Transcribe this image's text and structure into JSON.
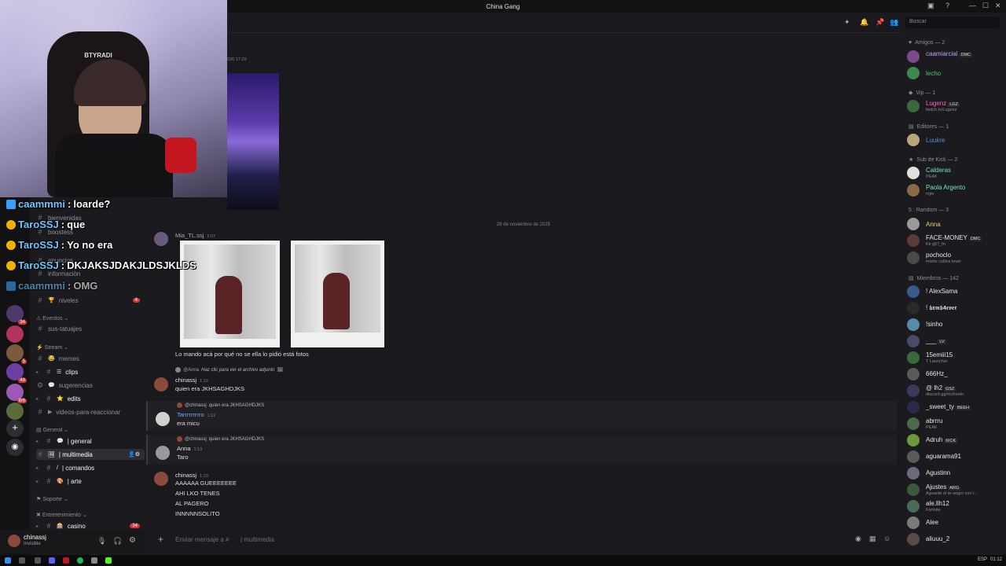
{
  "window": {
    "title": "China Gang"
  },
  "header": {
    "search_placeholder": "Buscar"
  },
  "chat_overlay": [
    {
      "user": "caammmi",
      "text": "loarde?"
    },
    {
      "user": "TaroSSJ",
      "text": "que"
    },
    {
      "user": "TaroSSJ",
      "text": "Yo no era"
    },
    {
      "user": "TaroSSJ",
      "text": "DKJAKSJDAKJLDSJKLDS"
    },
    {
      "user": "caammmi",
      "text": "OMG"
    }
  ],
  "channels": {
    "hidden": [
      {
        "name": "bienvenidas"
      },
      {
        "name": "boostess"
      },
      {
        "name": "anuncios"
      },
      {
        "name": "información"
      }
    ],
    "niveles": {
      "name": "niveles",
      "count": "4"
    },
    "cat_eventos": "Eventos",
    "sus_tatuajes": "sus-tatuajes",
    "cat_stream": "Stream",
    "memes": "memes",
    "clips": "clips",
    "sugerencias": "sugerencias",
    "edits": "edits",
    "videos": "videos-para-reaccionar",
    "cat_general": "General",
    "general": "| general",
    "multimedia": "| multimedia",
    "comandos": "| comandos",
    "arte": "| arte",
    "cat_soporte": "Soporte",
    "cat_entretenimiento": "Entretenimiento",
    "casino": "casino",
    "casino_count": "34"
  },
  "user_panel": {
    "name": "chinassj",
    "status": "Invisible"
  },
  "servers_badges": [
    "34",
    "5",
    "49",
    "8/8"
  ],
  "main": {
    "prev_time": "2020 17:29",
    "date_divider": "28 de noviembre de 2025",
    "poster": {
      "name": "Mia_TL.ssj",
      "time": "3:07"
    },
    "caption": "Lo mando acá por qué no se ella lo pidió está fotos",
    "messages": [
      {
        "reply_name": "@Anna",
        "reply_text": "Haz clic para ver el archivo adjunto",
        "author": "chinassj",
        "time": "1:12",
        "lines": [
          "quien era JKHSAGHDJKS"
        ]
      },
      {
        "reply_name": "@chinassj",
        "reply_text": "quien era JKHSAGHDJKS",
        "author": "Tarrrrrrrrro",
        "time": "1:12",
        "lines": [
          "era micu"
        ]
      },
      {
        "reply_name": "@chinassj",
        "reply_text": "quien era JKHSAGHDJKS",
        "author": "Anna",
        "time": "1:13",
        "lines": [
          "Taro"
        ]
      },
      {
        "reply_name": "",
        "reply_text": "",
        "author": "chinassj",
        "time": "1:13",
        "lines": [
          "AAAAAA GUEEEEEEE",
          "AHI LKO TENES",
          "AL PAGERO",
          "INNNNNSOLITO"
        ]
      }
    ],
    "input_placeholder": "Enviar mensaje a #",
    "input_channel": "| multimedia"
  },
  "members": {
    "groups": [
      {
        "label": "Amigos — 2",
        "members": [
          {
            "name": "caamiarcial",
            "tag": "DMC",
            "sub": ""
          },
          {
            "name": "lecho",
            "tag": "",
            "sub": ""
          }
        ]
      },
      {
        "label": "Vip — 1",
        "members": [
          {
            "name": "Lugenz",
            "tag": "LGZ",
            "sub": "twitch.tv/Lugenz"
          }
        ]
      },
      {
        "label": "Editores — 1",
        "members": [
          {
            "name": "Luukre",
            "tag": "",
            "sub": ""
          }
        ]
      },
      {
        "label": "Sub de Kick — 2",
        "members": [
          {
            "name": "Calderas",
            "tag": "",
            "sub": "PEAK"
          },
          {
            "name": "Paola Argento",
            "tag": "",
            "sub": "mjm"
          }
        ]
      },
      {
        "label": "5 : Random — 3",
        "members": [
          {
            "name": "Anna",
            "tag": "",
            "sub": ""
          },
          {
            "name": "FACE-MONEY",
            "tag": "DMC",
            "sub": "Kk g57_fn"
          },
          {
            "name": "pochoclo",
            "tag": "",
            "sub": "mishe collins lover"
          }
        ]
      },
      {
        "label": "Miembros — 142",
        "members": [
          {
            "name": "! AlexSama",
            "tag": "",
            "sub": ""
          },
          {
            "name": "! 𝖇𝖝𝖒𝖇𝟰𝖊𝖛𝖊𝖗",
            "tag": "",
            "sub": ""
          },
          {
            "name": "!sinho",
            "tag": "",
            "sub": ""
          },
          {
            "name": "___",
            "tag": "LV",
            "sub": ""
          },
          {
            "name": "15emiii15",
            "tag": "",
            "sub": "T Launcher"
          },
          {
            "name": "666Hz_",
            "tag": "",
            "sub": ""
          },
          {
            "name": "@ lh2",
            "tag": "GSZ",
            "sub": "discord.gg/mcfondo"
          },
          {
            "name": "_sweet_ty",
            "tag": "BEEH",
            "sub": ""
          },
          {
            "name": "abrrru",
            "tag": "",
            "sub": "PEAK"
          },
          {
            "name": "Adruh",
            "tag": "KICK",
            "sub": ""
          },
          {
            "name": "aguarama91",
            "tag": "",
            "sub": ""
          },
          {
            "name": "Agustinn",
            "tag": "",
            "sub": ""
          },
          {
            "name": "Ajustes",
            "tag": "ARG",
            "sub": "Aguante el te negro con l..."
          },
          {
            "name": "ale.llh12",
            "tag": "",
            "sub": "Fortnite"
          },
          {
            "name": "Alee",
            "tag": "",
            "sub": ""
          },
          {
            "name": "aliuuu_2",
            "tag": "",
            "sub": ""
          }
        ]
      }
    ]
  },
  "taskbar": {
    "lang": "ESP",
    "time": "01:12"
  },
  "colors": {
    "accent": "#5865f2",
    "online": "#23a55a",
    "badge": "#da373c"
  }
}
